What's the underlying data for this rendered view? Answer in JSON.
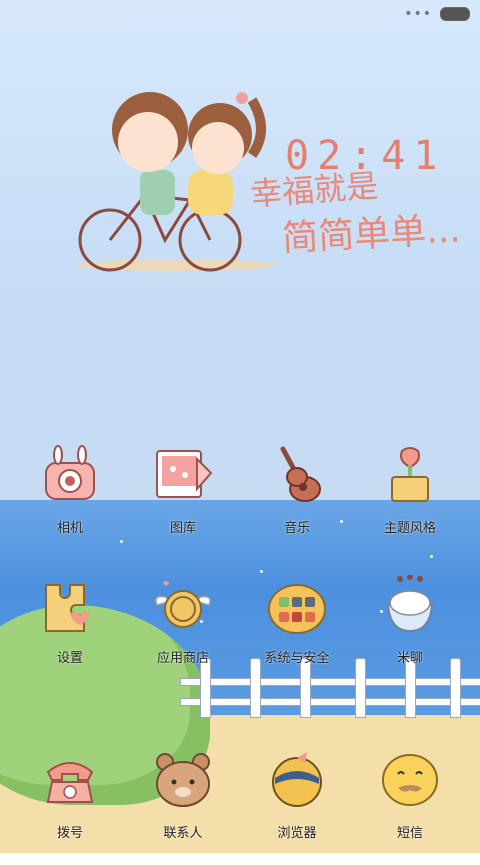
{
  "status_bar": {
    "overflow_indicator": "•••"
  },
  "clock": {
    "time": "02:41"
  },
  "motto": {
    "line1": "幸福就是",
    "line2": "简简单单..."
  },
  "apps": [
    {
      "label": "相机",
      "icon": "camera-icon"
    },
    {
      "label": "图库",
      "icon": "gallery-icon"
    },
    {
      "label": "音乐",
      "icon": "music-icon"
    },
    {
      "label": "主题风格",
      "icon": "theme-icon"
    },
    {
      "label": "设置",
      "icon": "settings-icon"
    },
    {
      "label": "应用商店",
      "icon": "app-store-icon"
    },
    {
      "label": "系统与安全",
      "icon": "system-security-icon"
    },
    {
      "label": "米聊",
      "icon": "miliao-icon"
    },
    {
      "label": "拨号",
      "icon": "phone-icon"
    },
    {
      "label": "联系人",
      "icon": "contacts-icon"
    },
    {
      "label": "浏览器",
      "icon": "browser-icon"
    },
    {
      "label": "短信",
      "icon": "messages-icon"
    }
  ],
  "colors": {
    "accent": "#e9897a",
    "sky": "#c5dcf6",
    "sea": "#4c90de",
    "sand": "#f4deaa"
  }
}
